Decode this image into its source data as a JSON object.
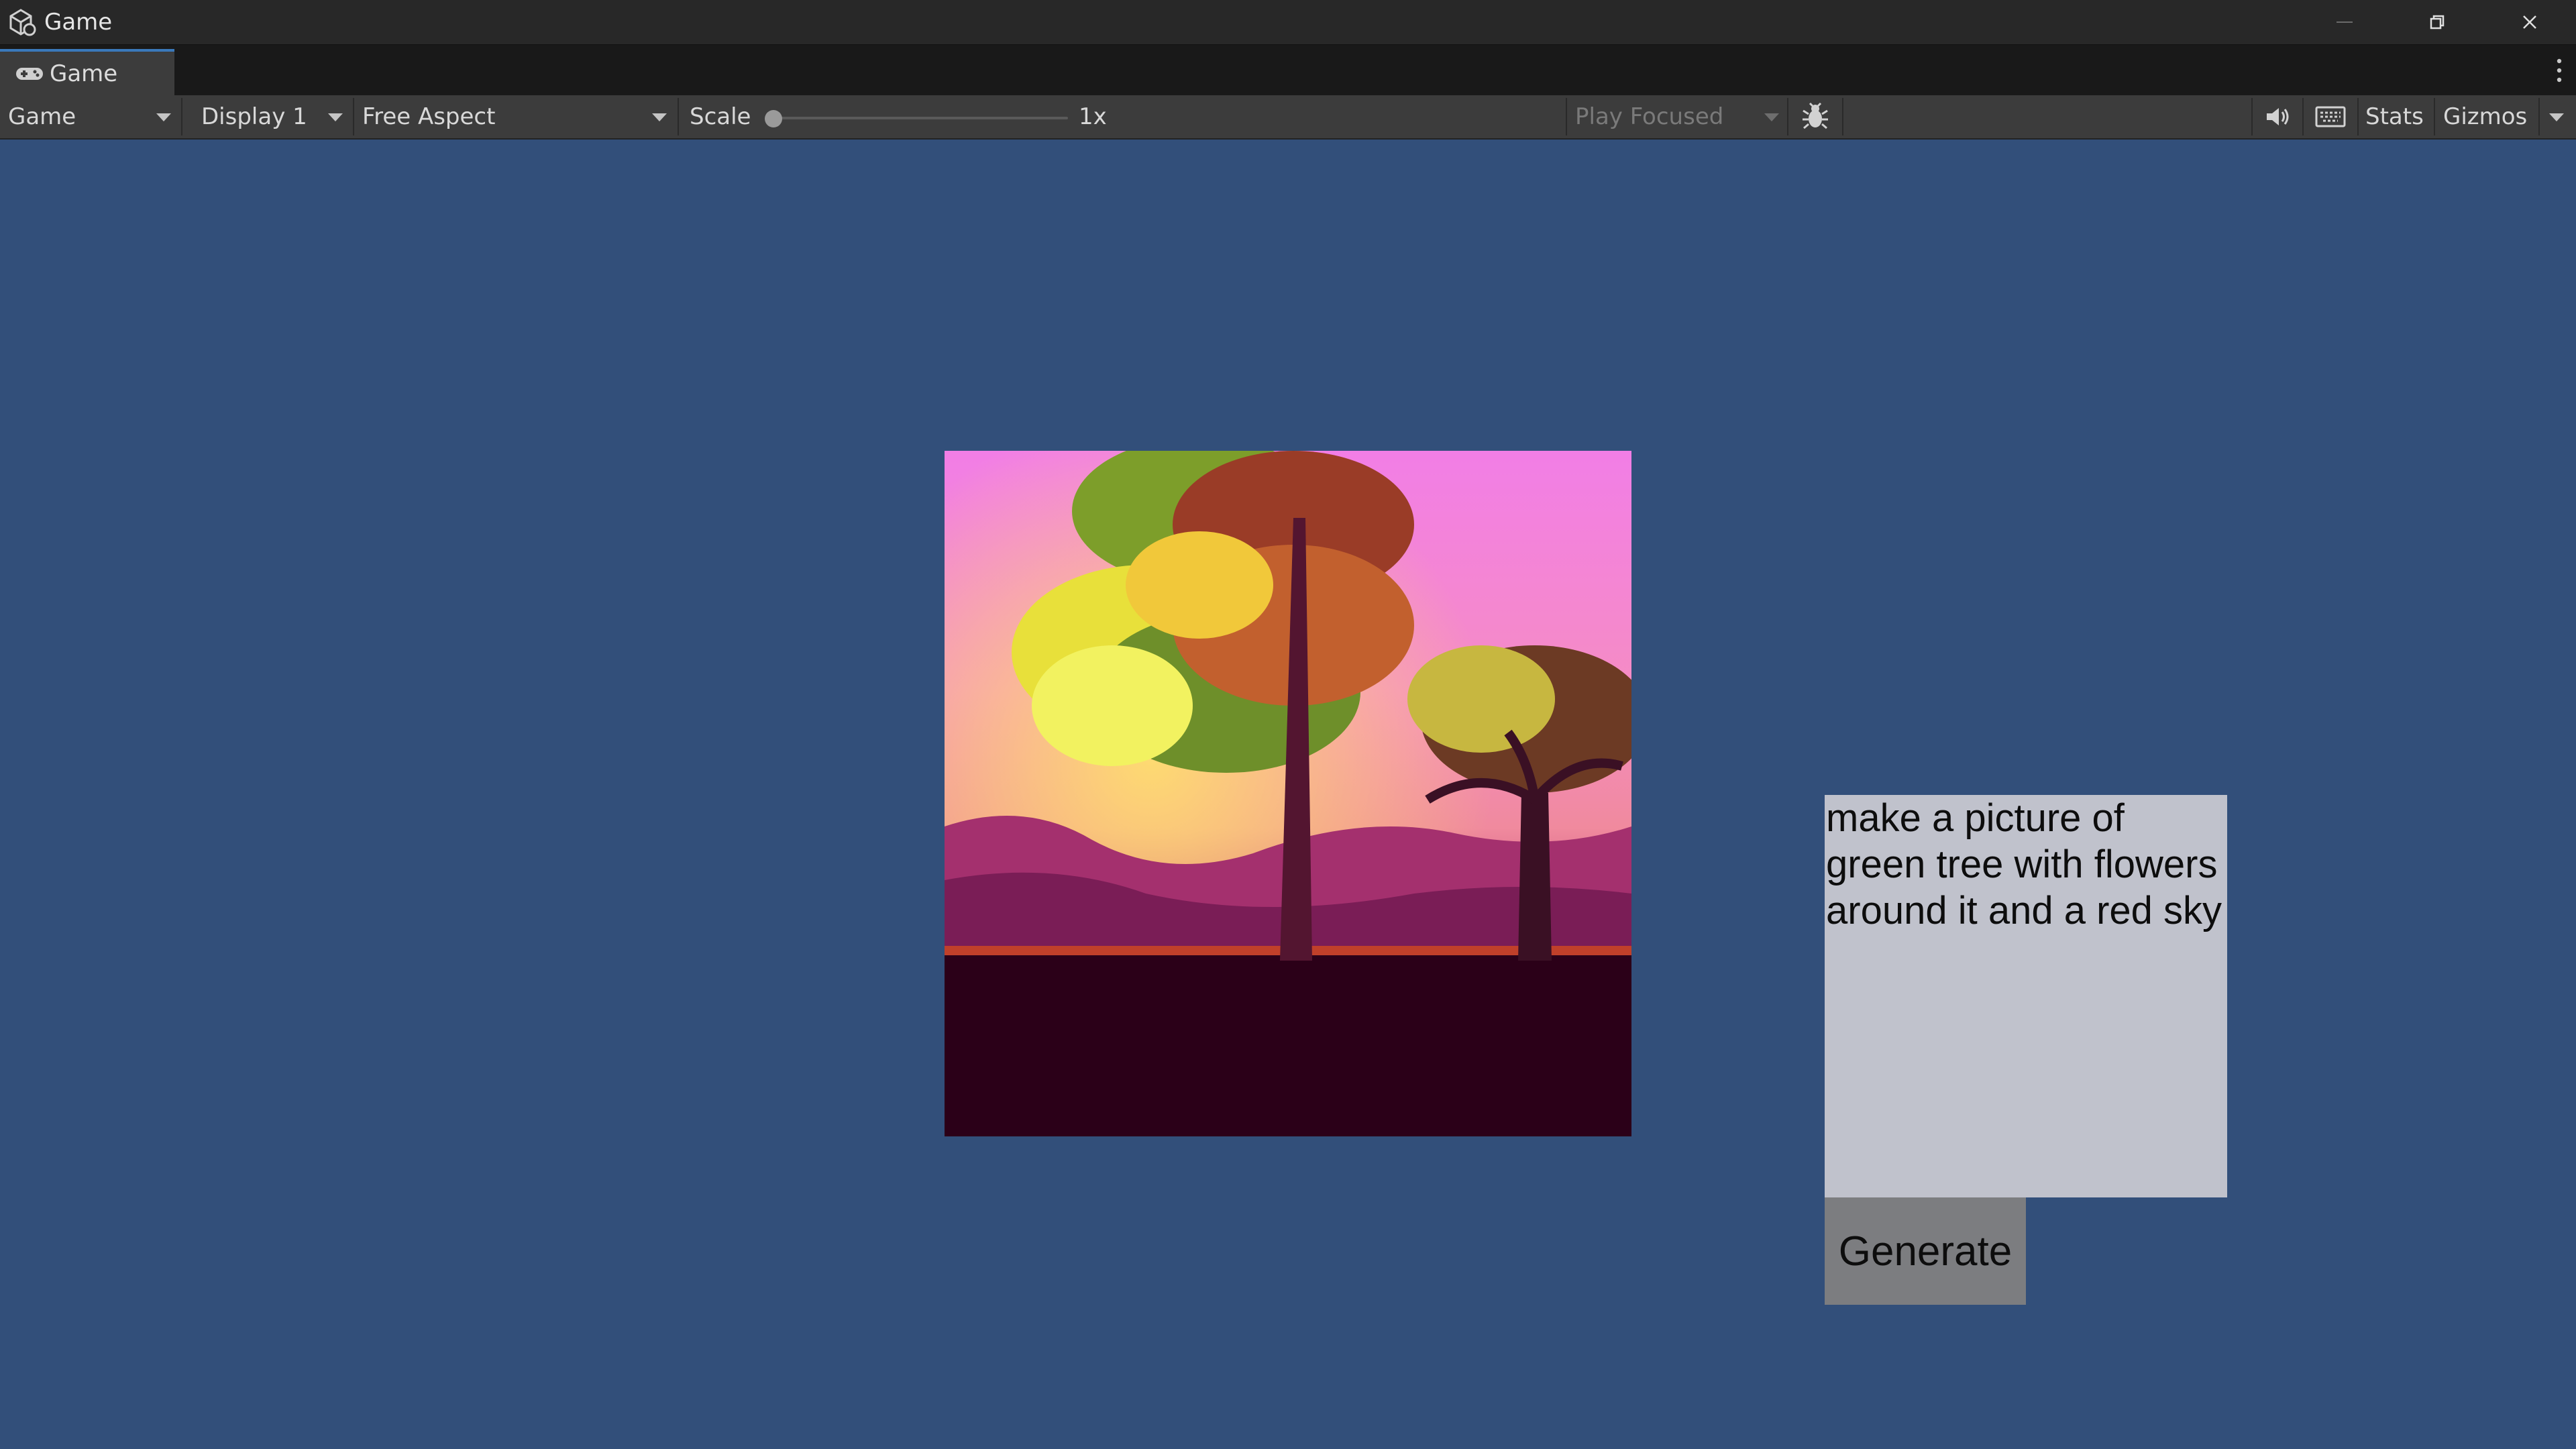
{
  "window": {
    "title": "Game",
    "icon": "unity-logo-icon"
  },
  "tab": {
    "label": "Game",
    "icon": "gamepad-icon"
  },
  "toolbar": {
    "view_mode": "Game",
    "display": "Display 1",
    "aspect": "Free Aspect",
    "scale_label": "Scale",
    "scale_value": "1x",
    "scale_slider_level": 0,
    "play_mode": "Play Focused",
    "stats_label": "Stats",
    "gizmos_label": "Gizmos",
    "icons": [
      "bug-icon",
      "speaker-icon",
      "keyboard-icon"
    ]
  },
  "game": {
    "image_description_icon": "generated-image",
    "prompt_text": "make a picture of green tree with flowers around it and a red sky",
    "generate_label": "Generate"
  },
  "colors": {
    "background": "#324f7a",
    "prompt_box": "#c0c2cc",
    "generate_button": "#7c7d80",
    "tab_accent": "#3a79bb"
  }
}
